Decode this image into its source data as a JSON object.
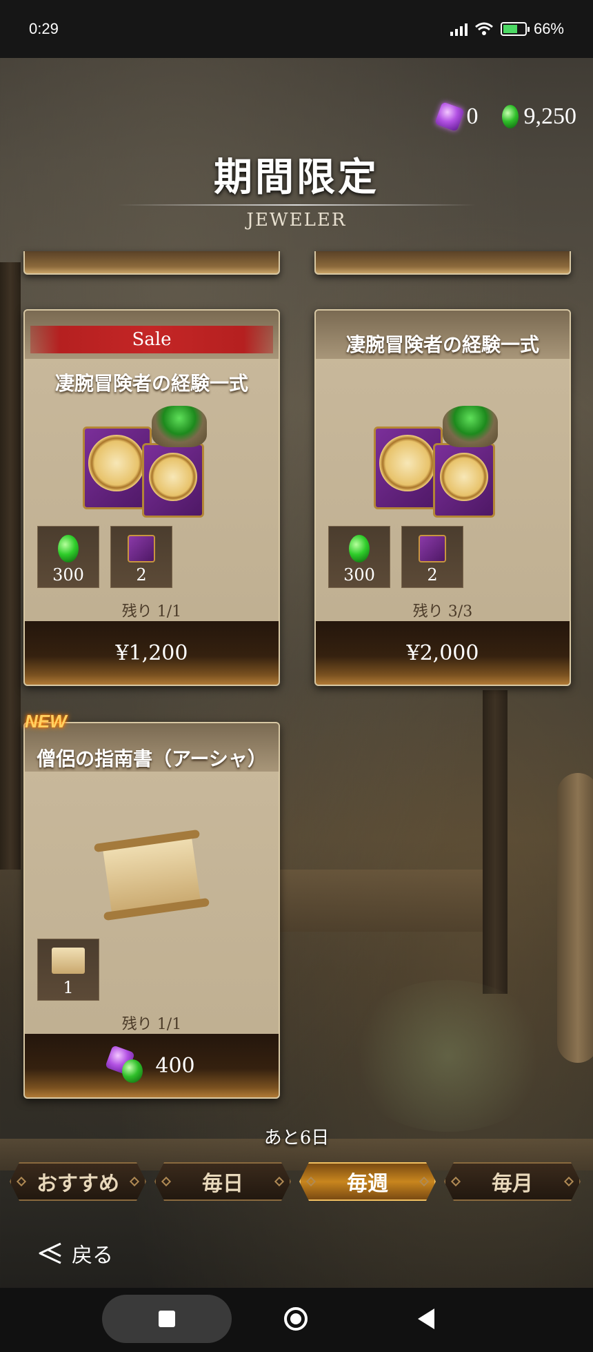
{
  "status": {
    "time": "0:29",
    "battery": "66%",
    "battery_level": 0.66
  },
  "currency": {
    "purple_gems": "0",
    "green_gems": "9,250"
  },
  "header": {
    "title": "期間限定",
    "subtitle": "JEWELER"
  },
  "cards": [
    {
      "badge": "Sale",
      "title": "凄腕冒険者の経験一式",
      "rewards": [
        {
          "icon": "green-gem-icon",
          "qty": "300"
        },
        {
          "icon": "experience-book-icon",
          "qty": "2"
        }
      ],
      "remaining": "残り 1/1",
      "price": "¥1,200"
    },
    {
      "title": "凄腕冒険者の経験一式",
      "rewards": [
        {
          "icon": "green-gem-icon",
          "qty": "300"
        },
        {
          "icon": "experience-book-icon",
          "qty": "2"
        }
      ],
      "remaining": "残り 3/3",
      "price": "¥2,000"
    },
    {
      "badge": "NEW",
      "title": "僧侶の指南書（アーシャ）",
      "rewards": [
        {
          "icon": "scroll-icon",
          "qty": "1"
        }
      ],
      "remaining": "残り 1/1",
      "price": "400",
      "price_icon": "gem-currency-icon"
    }
  ],
  "time_left": "あと6日",
  "tabs": [
    {
      "label": "おすすめ",
      "active": false
    },
    {
      "label": "毎日",
      "active": false
    },
    {
      "label": "毎週",
      "active": true
    },
    {
      "label": "毎月",
      "active": false
    }
  ],
  "back_label": "戻る"
}
